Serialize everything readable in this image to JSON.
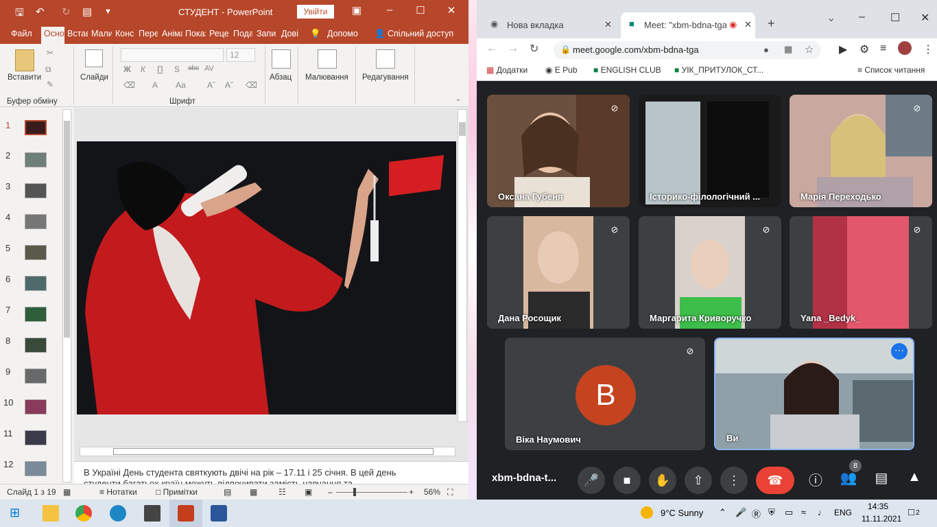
{
  "ppt": {
    "title": "СТУДЕНТ  -  PowerPoint",
    "signin": "Увійти",
    "tabs": [
      "Файл",
      "Осно",
      "Встав",
      "Мали",
      "Конс",
      "Пере",
      "Аніма",
      "Показ",
      "Реце",
      "Пода",
      "Запи",
      "Дові"
    ],
    "help": "Допомо",
    "share": "Спільний доступ",
    "paste": "Вставити",
    "slides": "Слайди",
    "clipboard": "Буфер обміну",
    "font_group": "Шрифт",
    "font_size": "12",
    "paragraph": "Абзац",
    "drawing": "Малювання",
    "editing": "Редагування",
    "slide_numbers": [
      "1",
      "2",
      "3",
      "4",
      "5",
      "6",
      "7",
      "8",
      "9",
      "10",
      "11",
      "12"
    ],
    "notes_line1": "В Україні День студента святкують двічі на рік – 17.11  і 25 січня. В цей день",
    "notes_line2": "студенти багатьох країн можуть відпочивати замість навчання та",
    "status_slide": "Слайд 1 з 19",
    "status_notes": "Нотатки",
    "status_comments": "Примітки",
    "zoom": "56%"
  },
  "chrome": {
    "tab1": "Нова вкладка",
    "tab2": "Meet: \"xbm-bdna-tga\"",
    "url": "meet.google.com/xbm-bdna-tga",
    "bookmarks": [
      "Додатки",
      "E Pub",
      "ENGLISH CLUB",
      "УІК_ПРИТУЛОК_СТ..."
    ],
    "reading_list": "Список читання"
  },
  "meet": {
    "participants": [
      "Оксана Губеня",
      "Історико-філологічний ...",
      "Марія Переходько",
      "Дана Росощик",
      "Маргарита Криворучко",
      "Yana _Bedyk_",
      "Віка Наумович",
      "Ви"
    ],
    "avatar_letter": "В",
    "meeting_code": "xbm-bdna-t...",
    "people_count": "8"
  },
  "taskbar": {
    "weather": "9°C  Sunny",
    "lang": "ENG",
    "time": "14:35",
    "date": "11.11.2021",
    "notifications": "2"
  },
  "colors": {
    "ppt_red": "#b7472a",
    "meet_bg": "#202124",
    "end_call": "#ea4335",
    "avatar": "#c5431f"
  }
}
